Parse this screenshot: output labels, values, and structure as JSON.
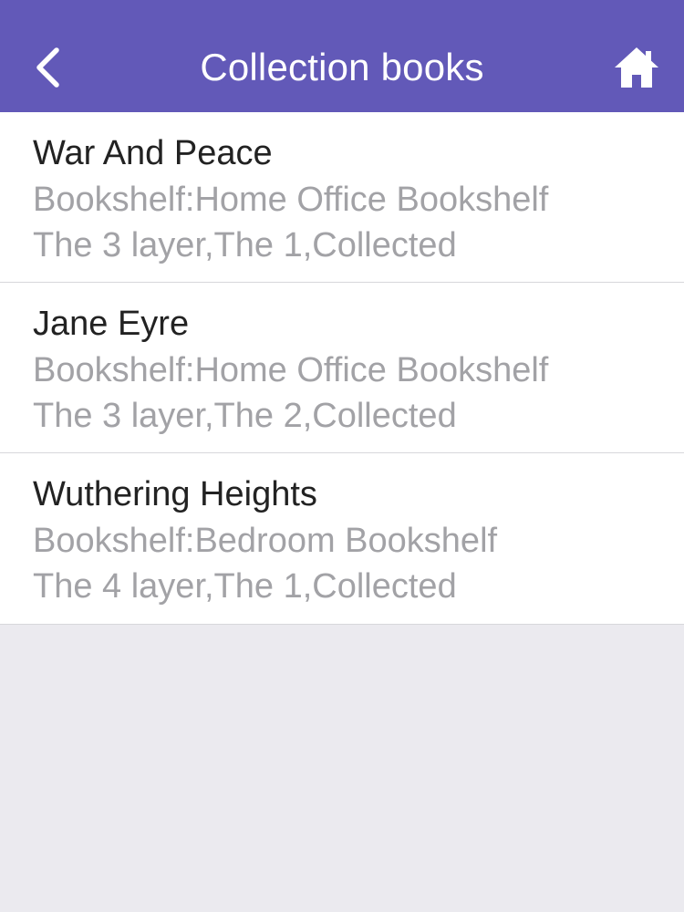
{
  "header": {
    "title": "Collection books",
    "back_icon": "chevron-left-icon",
    "home_icon": "home-icon",
    "background_color": "#6259b8"
  },
  "books": [
    {
      "title": "War And Peace",
      "bookshelf": "Bookshelf:Home Office Bookshelf",
      "position": "The 3 layer,The 1,Collected"
    },
    {
      "title": "Jane Eyre",
      "bookshelf": "Bookshelf:Home Office Bookshelf",
      "position": "The 3 layer,The 2,Collected"
    },
    {
      "title": "Wuthering Heights",
      "bookshelf": "Bookshelf:Bedroom Bookshelf",
      "position": "The 4 layer,The 1,Collected"
    }
  ]
}
